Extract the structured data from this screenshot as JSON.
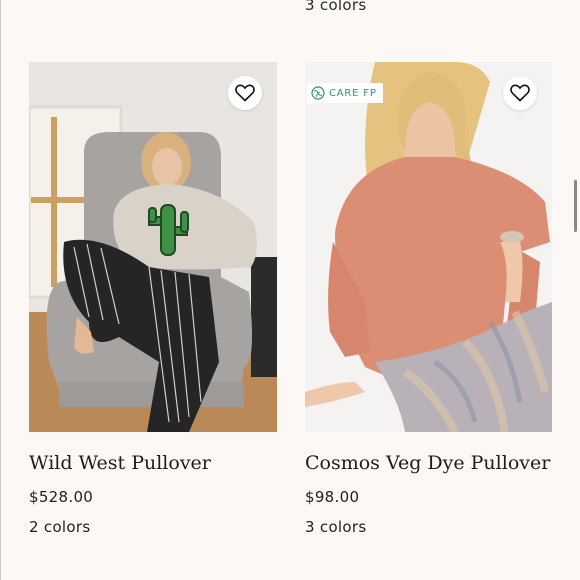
{
  "top_row": {
    "colors": "3 colors"
  },
  "products": [
    {
      "name": "Wild West Pullover",
      "price": "$528.00",
      "colors": "2 colors",
      "favorite_icon": "heart-outline-icon",
      "image": "model in cactus sweater seated in grey armchair"
    },
    {
      "name": "Cosmos Veg Dye Pullover",
      "price": "$98.00",
      "colors": "3 colors",
      "favorite_icon": "heart-outline-icon",
      "badge": "CARE FP",
      "badge_icon": "globe-leaf-icon",
      "image": "model in pink pullover sitting on floor"
    }
  ],
  "colors_theme": {
    "background": "#fbf8f6",
    "badge_text": "#2f8f86"
  }
}
